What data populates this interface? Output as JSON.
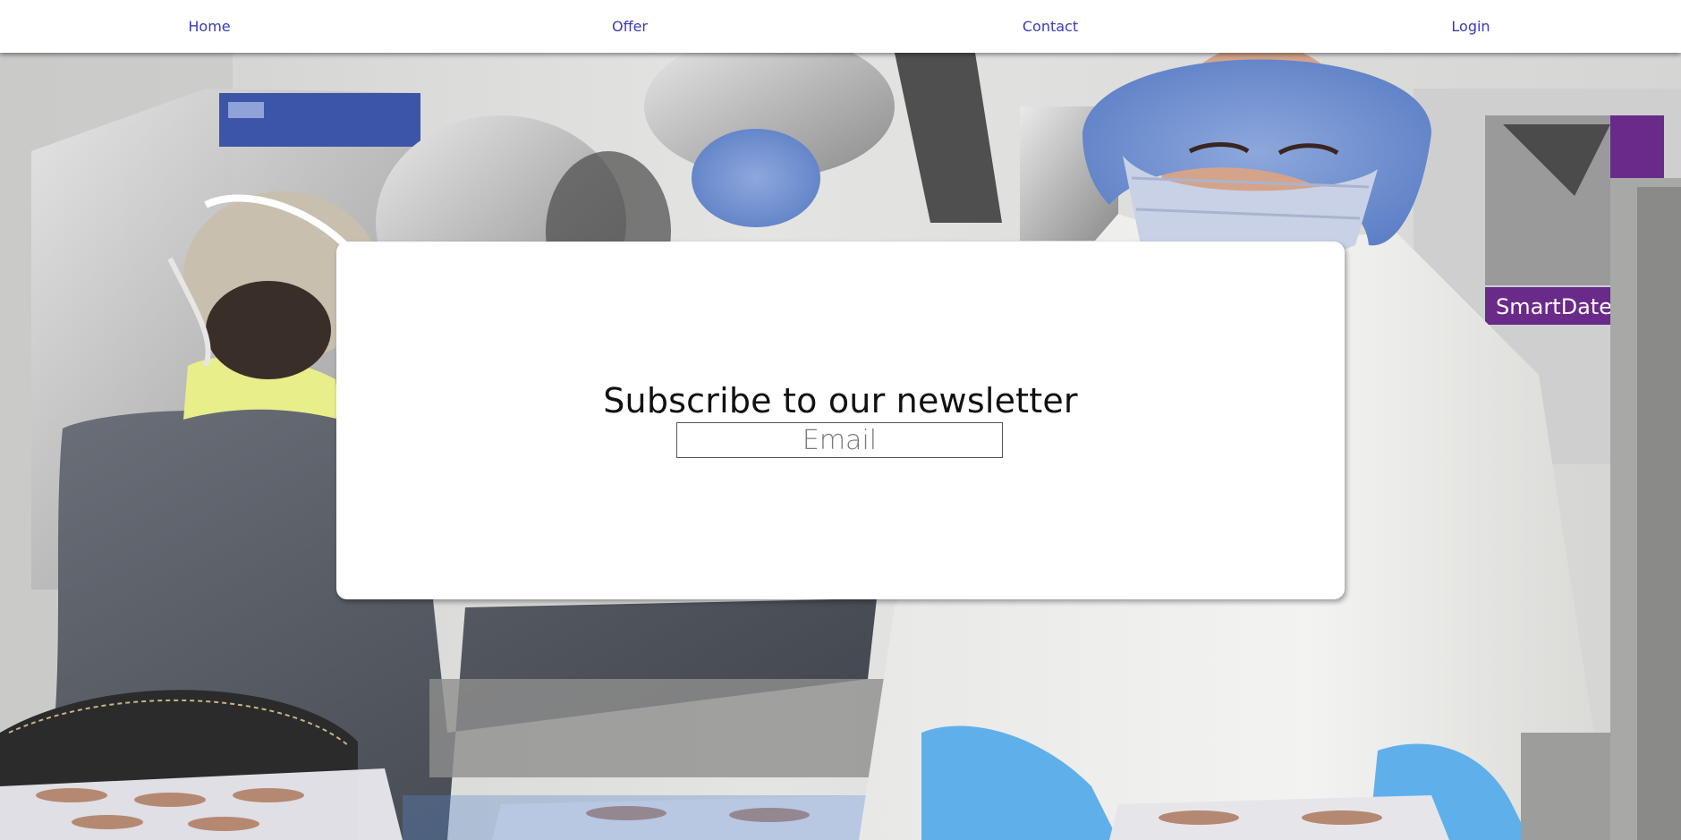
{
  "nav": {
    "items": [
      {
        "label": "Home"
      },
      {
        "label": "Offer"
      },
      {
        "label": "Contact"
      },
      {
        "label": "Login"
      }
    ],
    "link_color": "#3a3ab8"
  },
  "newsletter": {
    "title": "Subscribe to our newsletter",
    "email_placeholder": "Email",
    "email_value": ""
  },
  "hero": {
    "photo_sign_text": "SmartDate"
  }
}
